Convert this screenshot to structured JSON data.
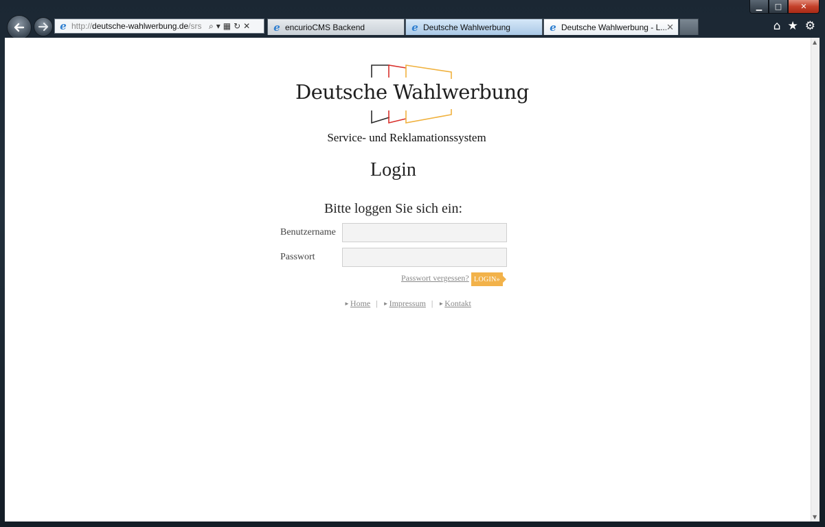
{
  "browser": {
    "address": {
      "scheme": "http://",
      "domain": "deutsche-wahlwerbung.de",
      "path": "/srs"
    },
    "tabs": [
      {
        "label": "encurioCMS Backend"
      },
      {
        "label": "Deutsche Wahlwerbung"
      },
      {
        "label": "Deutsche Wahlwerbung - L..."
      }
    ],
    "window_controls": {
      "minimize": "▁",
      "maximize": "□",
      "close": "✕"
    },
    "toolbar": {
      "home": "⌂",
      "favorites": "★",
      "tools": "⚙"
    }
  },
  "page": {
    "brand": "Deutsche Wahlwerbung",
    "subtitle": "Service- und Reklamationssystem",
    "title": "Login",
    "intro": "Bitte loggen Sie sich ein:",
    "form": {
      "username_label": "Benutzername",
      "username_value": "",
      "password_label": "Passwort",
      "password_value": "",
      "forgot_link": "Passwort vergessen?",
      "submit_label": "LOGIN»"
    },
    "footer_links": [
      {
        "label": "Home"
      },
      {
        "label": "Impressum"
      },
      {
        "label": "Kontakt"
      }
    ],
    "colors": {
      "logo_black": "#2a2a2a",
      "logo_red": "#d9302b",
      "logo_gold": "#f0b13d",
      "button": "#f2b24a"
    }
  }
}
